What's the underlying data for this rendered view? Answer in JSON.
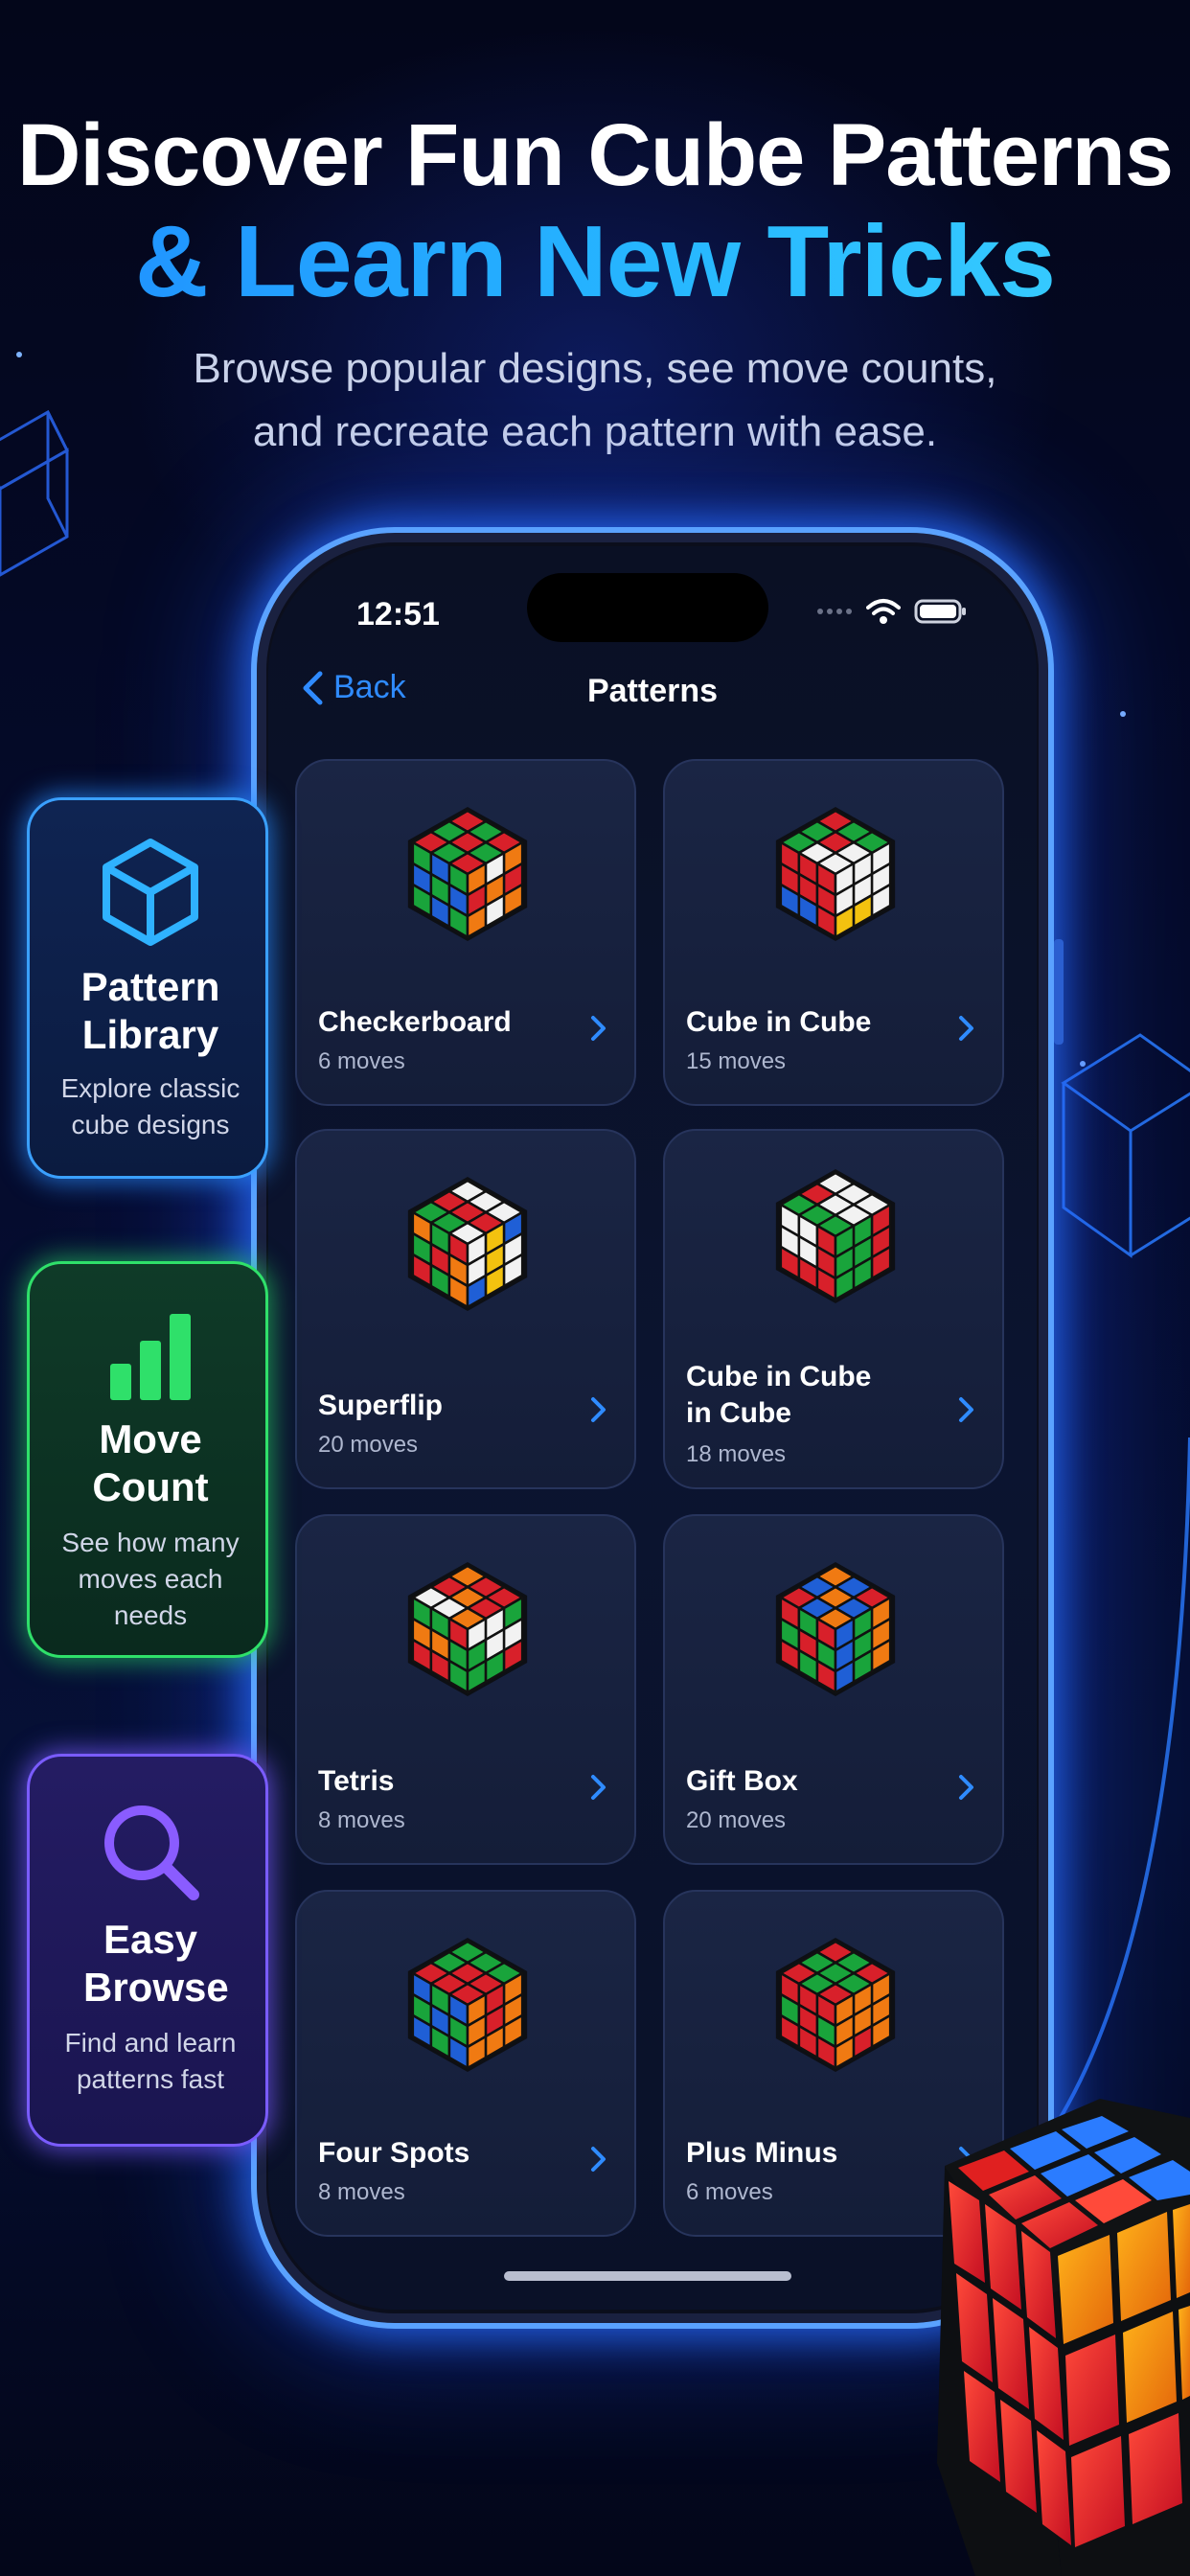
{
  "headline": {
    "line1": "Discover Fun Cube Patterns",
    "line2": "& Learn New Tricks",
    "subtitle_line1": "Browse popular designs, see move counts,",
    "subtitle_line2": "and recreate each pattern with ease."
  },
  "status_bar": {
    "time": "12:51",
    "icons": [
      "signal-dots-icon",
      "wifi-icon",
      "battery-icon"
    ]
  },
  "nav": {
    "back_label": "Back",
    "title": "Patterns"
  },
  "patterns": [
    {
      "name": "Checkerboard",
      "moves": "6 moves"
    },
    {
      "name": "Cube in Cube",
      "moves": "15 moves"
    },
    {
      "name": "Superflip",
      "moves": "20 moves"
    },
    {
      "name": "Cube in Cube in Cube",
      "moves": "18 moves"
    },
    {
      "name": "Tetris",
      "moves": "8 moves"
    },
    {
      "name": "Gift Box",
      "moves": "20 moves"
    },
    {
      "name": "Four Spots",
      "moves": "8 moves"
    },
    {
      "name": "Plus Minus",
      "moves": "6 moves"
    }
  ],
  "features": [
    {
      "icon": "cube-icon",
      "title": "Pattern Library",
      "description": "Explore classic cube designs",
      "accent": "#3aa0ff"
    },
    {
      "icon": "bar-chart-icon",
      "title": "Move Count",
      "description": "See how many moves each needs",
      "accent": "#2fe06a"
    },
    {
      "icon": "search-icon",
      "title": "Easy Browse",
      "description": "Find and learn patterns fast",
      "accent": "#7a5cff"
    }
  ],
  "colors": {
    "accent_blue": "#2f8bff",
    "cube_white": "#f2f2f2",
    "cube_red": "#d8202a",
    "cube_green": "#19a43b",
    "cube_blue": "#1f5fd6",
    "cube_orange": "#f07a12",
    "cube_yellow": "#f3c20f"
  }
}
